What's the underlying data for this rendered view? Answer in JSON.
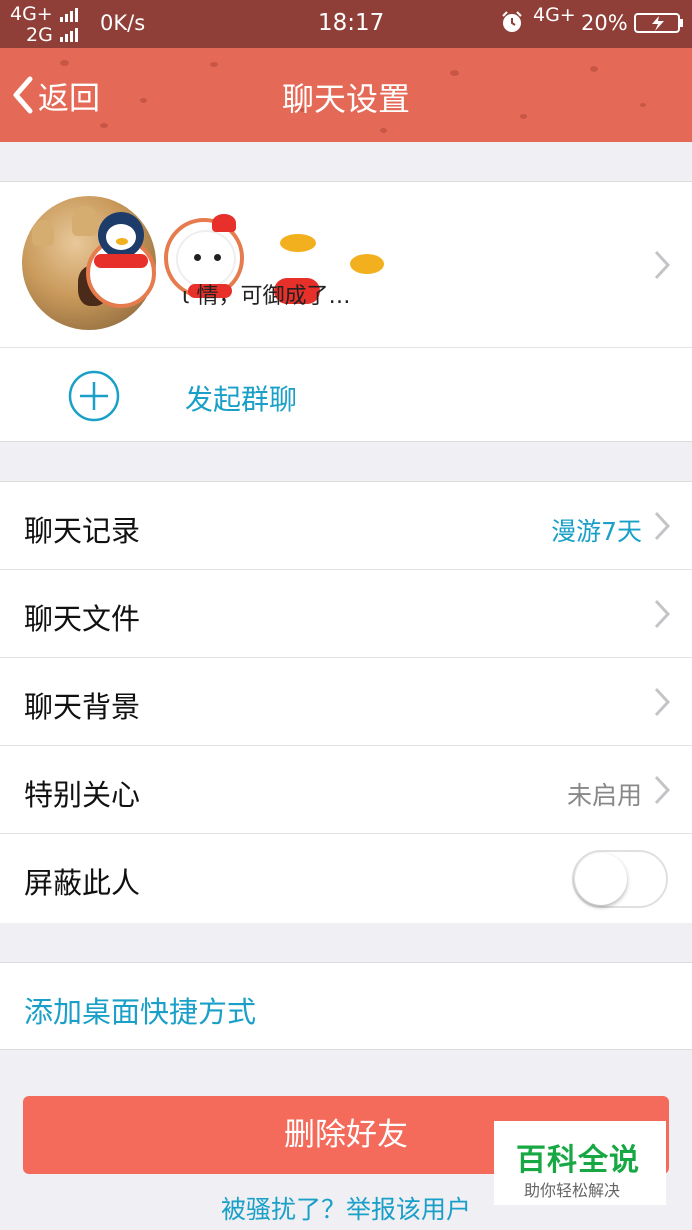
{
  "status_bar": {
    "network_primary": "4G+",
    "network_secondary": "2G",
    "speed": "0K/s",
    "time": "18:17",
    "network_right": "4G+",
    "battery_percent": "20%"
  },
  "header": {
    "back_label": "返回",
    "title": "聊天设置"
  },
  "profile": {
    "signature": "ι      情，可御成了…"
  },
  "group_chat": {
    "label": "发起群聊"
  },
  "settings": {
    "rows": [
      {
        "label": "聊天记录",
        "value": "漫游7天",
        "value_color": "#1aa0c8"
      },
      {
        "label": "聊天文件",
        "value": ""
      },
      {
        "label": "聊天背景",
        "value": ""
      },
      {
        "label": "特别关心",
        "value": "未启用",
        "value_color": "#888888"
      },
      {
        "label": "屏蔽此人",
        "toggle": false
      }
    ]
  },
  "shortcut": {
    "label": "添加桌面快捷方式"
  },
  "actions": {
    "delete_label": "删除好友",
    "report_label": "被骚扰了？举报该用户"
  },
  "watermark": {
    "title": "百科全说",
    "subtitle": "助你轻松解决"
  },
  "colors": {
    "accent": "#1aa0c8",
    "header": "#e46a57",
    "danger": "#f46b5b"
  }
}
